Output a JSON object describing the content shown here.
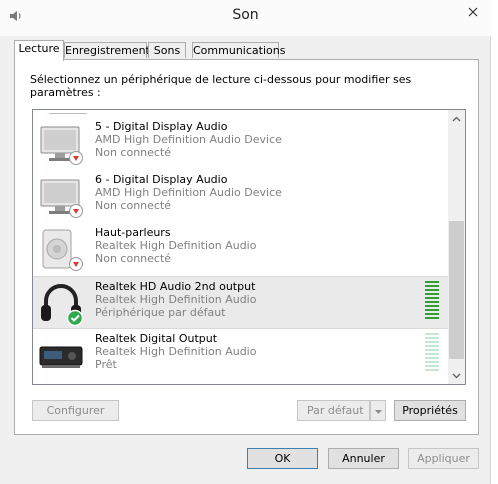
{
  "window": {
    "title": "Son"
  },
  "tabs": [
    {
      "label": "Lecture"
    },
    {
      "label": "Enregistrement"
    },
    {
      "label": "Sons"
    },
    {
      "label": "Communications"
    }
  ],
  "instruction": "Sélectionnez un périphérique de lecture ci-dessous pour modifier ses paramètres :",
  "devices": [
    {
      "name": "5 - Digital Display Audio",
      "driver": "AMD High Definition Audio Device",
      "status": "Non connecté",
      "icon": "monitor-icon",
      "badge": "disconnected-badge-icon"
    },
    {
      "name": "6 - Digital Display Audio",
      "driver": "AMD High Definition Audio Device",
      "status": "Non connecté",
      "icon": "monitor-icon",
      "badge": "disconnected-badge-icon"
    },
    {
      "name": "Haut-parleurs",
      "driver": "Realtek High Definition Audio",
      "status": "Non connecté",
      "icon": "speaker-icon",
      "badge": "disconnected-badge-icon"
    },
    {
      "name": "Realtek HD Audio 2nd output",
      "driver": "Realtek High Definition Audio",
      "status": "Périphérique par défaut",
      "icon": "headphones-icon",
      "badge": "default-check-badge-icon"
    },
    {
      "name": "Realtek Digital Output",
      "driver": "Realtek High Definition Audio",
      "status": "Prêt",
      "icon": "digital-output-icon",
      "badge": ""
    }
  ],
  "buttons": {
    "configure": "Configurer",
    "set_default": "Par défaut",
    "properties": "Propriétés",
    "ok": "OK",
    "cancel": "Annuler",
    "apply": "Appliquer"
  },
  "colors": {
    "meter_active": "#2fa12f",
    "meter_idle": "#c9e6d3",
    "badge_red": "#d43a2f",
    "badge_green": "#2fa84f"
  }
}
